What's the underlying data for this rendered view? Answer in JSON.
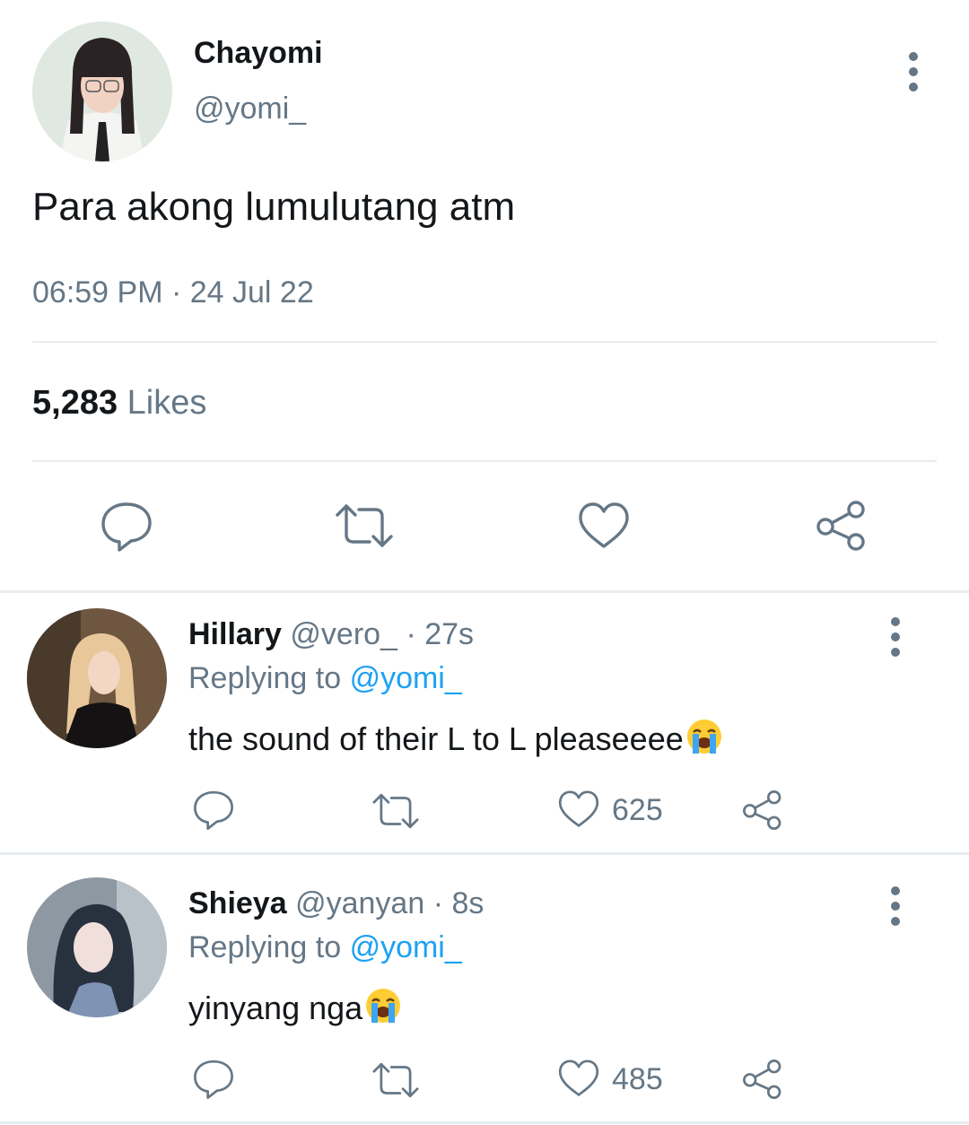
{
  "tweet": {
    "author_name": "Chayomi",
    "author_handle": "@yomi_",
    "text": "Para akong lumulutang atm",
    "timestamp": "06:59 PM · 24 Jul 22",
    "likes_count": "5,283",
    "likes_label": "Likes"
  },
  "replies": [
    {
      "name": "Hillary",
      "handle": "@vero_",
      "time": "· 27s",
      "replying_label": "Replying to",
      "replying_handle": "@yomi_",
      "text": "the sound of their L to L pleaseeee",
      "emoji": "loudly-crying-face",
      "likes": "625"
    },
    {
      "name": "Shieya",
      "handle": "@yanyan",
      "time": "· 8s",
      "replying_label": "Replying to",
      "replying_handle": "@yomi_",
      "text": "yinyang nga",
      "emoji": "loudly-crying-face",
      "likes": "485"
    }
  ],
  "colors": {
    "text": "#14171a",
    "muted": "#657786",
    "link": "#1da1f2",
    "divider": "#e6ecf0"
  },
  "icons": [
    "reply-icon",
    "retweet-icon",
    "like-icon",
    "share-icon",
    "more-options-icon"
  ]
}
